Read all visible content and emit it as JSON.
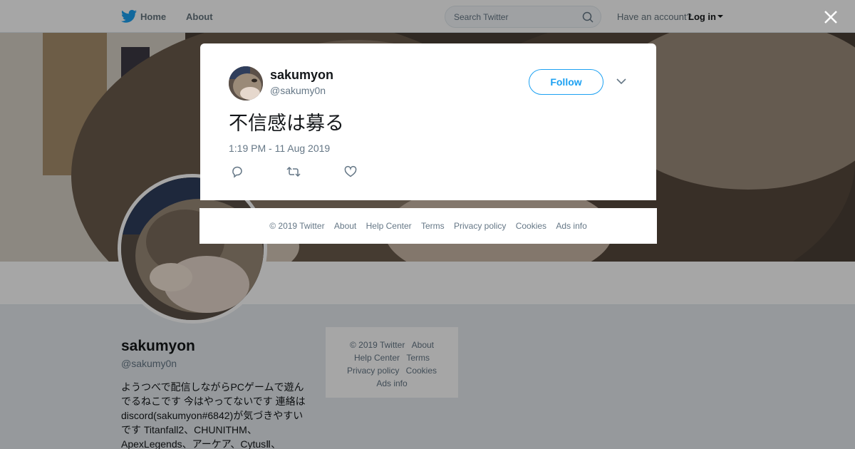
{
  "header": {
    "nav_home": "Home",
    "nav_about": "About",
    "search_placeholder": "Search Twitter",
    "have_account": "Have an account?",
    "login": "Log in"
  },
  "profile": {
    "name": "sakumyon",
    "handle": "@sakumy0n",
    "bio": "ようつべで配信しながらPCゲームで遊んでるねこです 今はやってないです 連絡はdiscord(sakumyon#6842)が気づきやすいです Titanfall2、CHUNITHM、ApexLegends、アーケア、CytusⅡ、"
  },
  "side_footer": {
    "copyright": "© 2019 Twitter",
    "about": "About",
    "help": "Help Center",
    "terms": "Terms",
    "privacy": "Privacy policy",
    "cookies": "Cookies",
    "ads": "Ads info"
  },
  "tweet": {
    "author_name": "sakumyon",
    "author_handle": "@sakumy0n",
    "follow_label": "Follow",
    "text": "不信感は募る",
    "timestamp": "1:19 PM - 11 Aug 2019"
  },
  "modal_footer": {
    "copyright": "© 2019 Twitter",
    "about": "About",
    "help": "Help Center",
    "terms": "Terms",
    "privacy": "Privacy policy",
    "cookies": "Cookies",
    "ads": "Ads info"
  },
  "colors": {
    "brand_blue": "#1da1f2",
    "text_secondary": "#657786"
  },
  "icons": [
    "twitter-bird-icon",
    "search-icon",
    "caret-down-icon",
    "close-icon",
    "chevron-down-icon",
    "reply-icon",
    "retweet-icon",
    "like-icon"
  ]
}
